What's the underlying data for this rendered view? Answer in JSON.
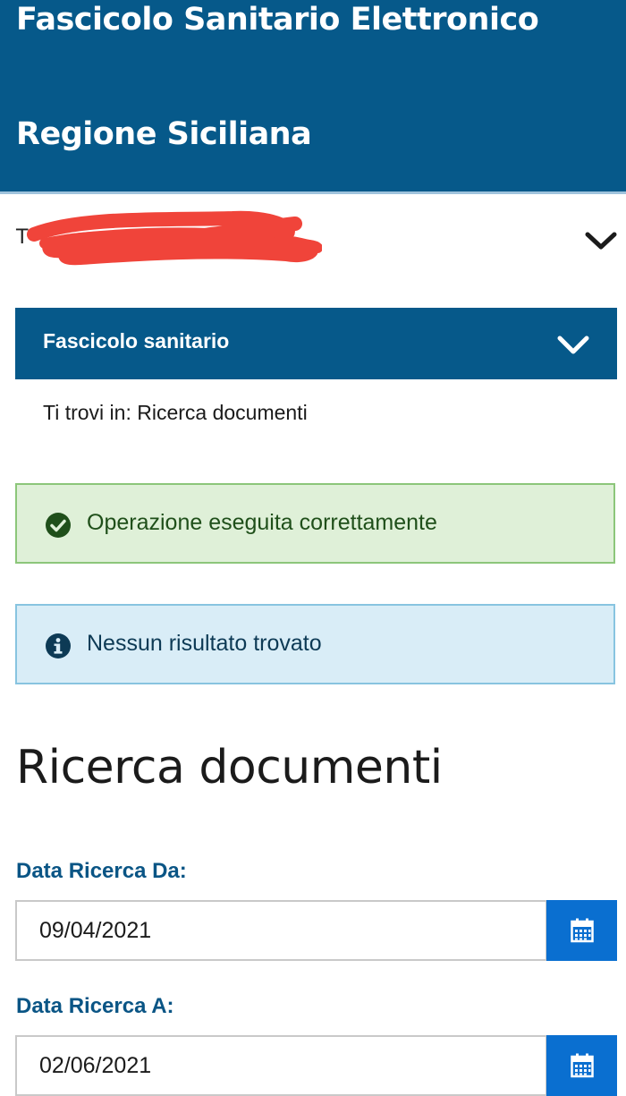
{
  "header": {
    "title_line1": "Fascicolo Sanitario Elettronico",
    "title_line2": "Regione Siciliana"
  },
  "user": {
    "name_visible": "T",
    "name_redacted": true,
    "expand_icon": "chevron-down-icon"
  },
  "menu": {
    "label": "Fascicolo sanitario",
    "expand_icon": "chevron-down-icon"
  },
  "breadcrumb": {
    "text": "Ti trovi in: Ricerca documenti"
  },
  "alerts": [
    {
      "type": "success",
      "icon": "check-circle-icon",
      "message": "Operazione eseguita correttamente"
    },
    {
      "type": "info",
      "icon": "info-circle-icon",
      "message": "Nessun risultato trovato"
    }
  ],
  "page": {
    "title": "Ricerca documenti"
  },
  "form": {
    "date_from": {
      "label": "Data Ricerca Da:",
      "value": "09/04/2021",
      "button_icon": "calendar-icon"
    },
    "date_to": {
      "label": "Data Ricerca A:",
      "value": "02/06/2021",
      "button_icon": "calendar-icon"
    }
  },
  "colors": {
    "header_bg": "#06598a",
    "menu_bg": "#06598a",
    "success_bg": "#dff0d8",
    "info_bg": "#d9edf7",
    "calendar_button": "#0a6fd0",
    "label_blue": "#0a5585"
  }
}
